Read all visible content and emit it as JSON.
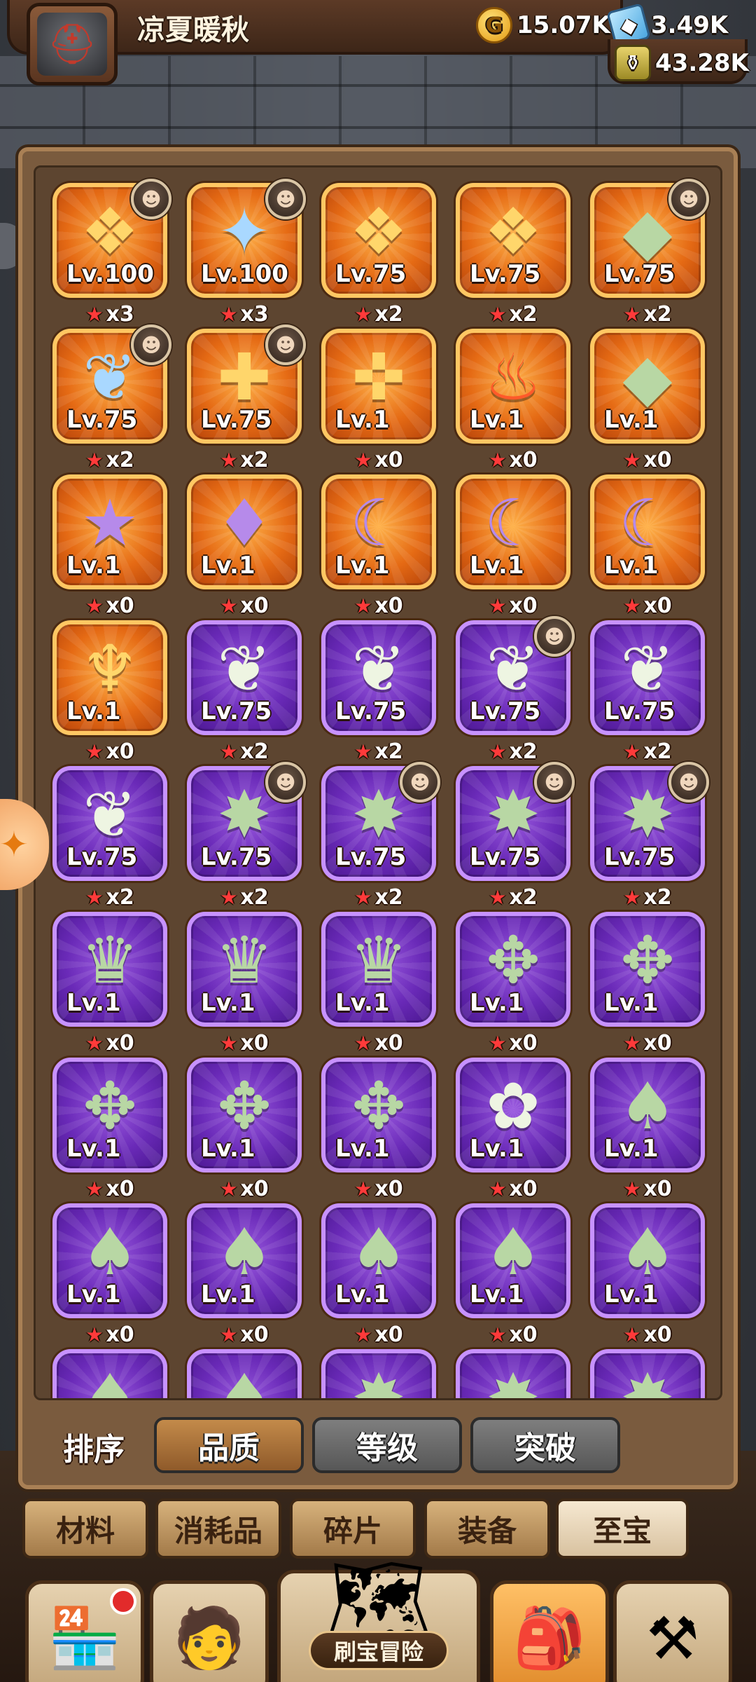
{
  "player": {
    "name": "凉夏暖秋",
    "avatar_icon": "knight-helmet"
  },
  "resources": {
    "gold": "15.07K",
    "gems": "3.49K",
    "potion": "43.28K"
  },
  "items": [
    {
      "lv": "Lv.100",
      "stars": "x3",
      "rarity": "orange",
      "art": "❖",
      "tone": "gold",
      "hero": "☻"
    },
    {
      "lv": "Lv.100",
      "stars": "x3",
      "rarity": "orange",
      "art": "✦",
      "tone": "blue",
      "hero": "☻"
    },
    {
      "lv": "Lv.75",
      "stars": "x2",
      "rarity": "orange",
      "art": "❖",
      "tone": "gold",
      "hero": ""
    },
    {
      "lv": "Lv.75",
      "stars": "x2",
      "rarity": "orange",
      "art": "❖",
      "tone": "gold",
      "hero": ""
    },
    {
      "lv": "Lv.75",
      "stars": "x2",
      "rarity": "orange",
      "art": "◆",
      "tone": "green",
      "hero": "☻"
    },
    {
      "lv": "Lv.75",
      "stars": "x2",
      "rarity": "orange",
      "art": "❦",
      "tone": "blue",
      "hero": "☻"
    },
    {
      "lv": "Lv.75",
      "stars": "x2",
      "rarity": "orange",
      "art": "✚",
      "tone": "gold",
      "hero": "☻"
    },
    {
      "lv": "Lv.1",
      "stars": "x0",
      "rarity": "orange",
      "art": "✜",
      "tone": "gold",
      "hero": ""
    },
    {
      "lv": "Lv.1",
      "stars": "x0",
      "rarity": "orange",
      "art": "♨",
      "tone": "red",
      "hero": ""
    },
    {
      "lv": "Lv.1",
      "stars": "x0",
      "rarity": "orange",
      "art": "◆",
      "tone": "green",
      "hero": ""
    },
    {
      "lv": "Lv.1",
      "stars": "x0",
      "rarity": "orange",
      "art": "★",
      "tone": "violet",
      "hero": ""
    },
    {
      "lv": "Lv.1",
      "stars": "x0",
      "rarity": "orange",
      "art": "♦",
      "tone": "violet",
      "hero": ""
    },
    {
      "lv": "Lv.1",
      "stars": "x0",
      "rarity": "orange",
      "art": "☾",
      "tone": "violet",
      "hero": ""
    },
    {
      "lv": "Lv.1",
      "stars": "x0",
      "rarity": "orange",
      "art": "☾",
      "tone": "violet",
      "hero": ""
    },
    {
      "lv": "Lv.1",
      "stars": "x0",
      "rarity": "orange",
      "art": "☾",
      "tone": "violet",
      "hero": ""
    },
    {
      "lv": "Lv.1",
      "stars": "x0",
      "rarity": "orange",
      "art": "♆",
      "tone": "gold",
      "hero": ""
    },
    {
      "lv": "Lv.75",
      "stars": "x2",
      "rarity": "purple",
      "art": "❦",
      "tone": "pearl",
      "hero": ""
    },
    {
      "lv": "Lv.75",
      "stars": "x2",
      "rarity": "purple",
      "art": "❦",
      "tone": "pearl",
      "hero": ""
    },
    {
      "lv": "Lv.75",
      "stars": "x2",
      "rarity": "purple",
      "art": "❦",
      "tone": "pearl",
      "hero": "☻"
    },
    {
      "lv": "Lv.75",
      "stars": "x2",
      "rarity": "purple",
      "art": "❦",
      "tone": "pearl",
      "hero": ""
    },
    {
      "lv": "Lv.75",
      "stars": "x2",
      "rarity": "purple",
      "art": "❦",
      "tone": "pearl",
      "hero": ""
    },
    {
      "lv": "Lv.75",
      "stars": "x2",
      "rarity": "purple",
      "art": "✸",
      "tone": "green",
      "hero": "☻"
    },
    {
      "lv": "Lv.75",
      "stars": "x2",
      "rarity": "purple",
      "art": "✸",
      "tone": "green",
      "hero": "☻"
    },
    {
      "lv": "Lv.75",
      "stars": "x2",
      "rarity": "purple",
      "art": "✸",
      "tone": "green",
      "hero": "☻"
    },
    {
      "lv": "Lv.75",
      "stars": "x2",
      "rarity": "purple",
      "art": "✸",
      "tone": "green",
      "hero": "☻"
    },
    {
      "lv": "Lv.1",
      "stars": "x0",
      "rarity": "purple",
      "art": "♛",
      "tone": "green",
      "hero": ""
    },
    {
      "lv": "Lv.1",
      "stars": "x0",
      "rarity": "purple",
      "art": "♛",
      "tone": "green",
      "hero": ""
    },
    {
      "lv": "Lv.1",
      "stars": "x0",
      "rarity": "purple",
      "art": "♛",
      "tone": "green",
      "hero": ""
    },
    {
      "lv": "Lv.1",
      "stars": "x0",
      "rarity": "purple",
      "art": "✥",
      "tone": "green",
      "hero": ""
    },
    {
      "lv": "Lv.1",
      "stars": "x0",
      "rarity": "purple",
      "art": "✥",
      "tone": "green",
      "hero": ""
    },
    {
      "lv": "Lv.1",
      "stars": "x0",
      "rarity": "purple",
      "art": "✥",
      "tone": "green",
      "hero": ""
    },
    {
      "lv": "Lv.1",
      "stars": "x0",
      "rarity": "purple",
      "art": "✥",
      "tone": "green",
      "hero": ""
    },
    {
      "lv": "Lv.1",
      "stars": "x0",
      "rarity": "purple",
      "art": "✥",
      "tone": "green",
      "hero": ""
    },
    {
      "lv": "Lv.1",
      "stars": "x0",
      "rarity": "purple",
      "art": "✿",
      "tone": "pearl",
      "hero": ""
    },
    {
      "lv": "Lv.1",
      "stars": "x0",
      "rarity": "purple",
      "art": "♠",
      "tone": "green",
      "hero": ""
    },
    {
      "lv": "Lv.1",
      "stars": "x0",
      "rarity": "purple",
      "art": "♠",
      "tone": "green",
      "hero": ""
    },
    {
      "lv": "Lv.1",
      "stars": "x0",
      "rarity": "purple",
      "art": "♠",
      "tone": "green",
      "hero": ""
    },
    {
      "lv": "Lv.1",
      "stars": "x0",
      "rarity": "purple",
      "art": "♠",
      "tone": "green",
      "hero": ""
    },
    {
      "lv": "Lv.1",
      "stars": "x0",
      "rarity": "purple",
      "art": "♠",
      "tone": "green",
      "hero": ""
    },
    {
      "lv": "Lv.1",
      "stars": "x0",
      "rarity": "purple",
      "art": "♠",
      "tone": "green",
      "hero": ""
    },
    {
      "lv": "",
      "stars": "",
      "rarity": "purple",
      "art": "♠",
      "tone": "green",
      "hero": ""
    },
    {
      "lv": "",
      "stars": "",
      "rarity": "purple",
      "art": "♠",
      "tone": "green",
      "hero": ""
    },
    {
      "lv": "",
      "stars": "",
      "rarity": "purple",
      "art": "✸",
      "tone": "green",
      "hero": ""
    },
    {
      "lv": "",
      "stars": "",
      "rarity": "purple",
      "art": "✸",
      "tone": "green",
      "hero": ""
    },
    {
      "lv": "",
      "stars": "",
      "rarity": "purple",
      "art": "✸",
      "tone": "green",
      "hero": ""
    }
  ],
  "sort": {
    "label": "排序",
    "options": [
      {
        "label": "品质",
        "active": true
      },
      {
        "label": "等级",
        "active": false
      },
      {
        "label": "突破",
        "active": false
      }
    ]
  },
  "categories": [
    {
      "label": "材料",
      "active": false
    },
    {
      "label": "消耗品",
      "active": false
    },
    {
      "label": "碎片",
      "active": false
    },
    {
      "label": "装备",
      "active": false
    },
    {
      "label": "至宝",
      "active": true
    }
  ],
  "nav": {
    "shop_icon": "shop-icon",
    "hero_icon": "hero-icon",
    "adventure_label": "刷宝冒险",
    "bag_icon": "backpack-icon",
    "forge_icon": "hammer-icon"
  },
  "colors": {
    "orange_tile": "#e56a14",
    "purple_tile": "#6a2ab8",
    "panel": "#7a5b3e",
    "active_sort": "#c38a4a",
    "inactive_sort": "#6e6e6e"
  }
}
